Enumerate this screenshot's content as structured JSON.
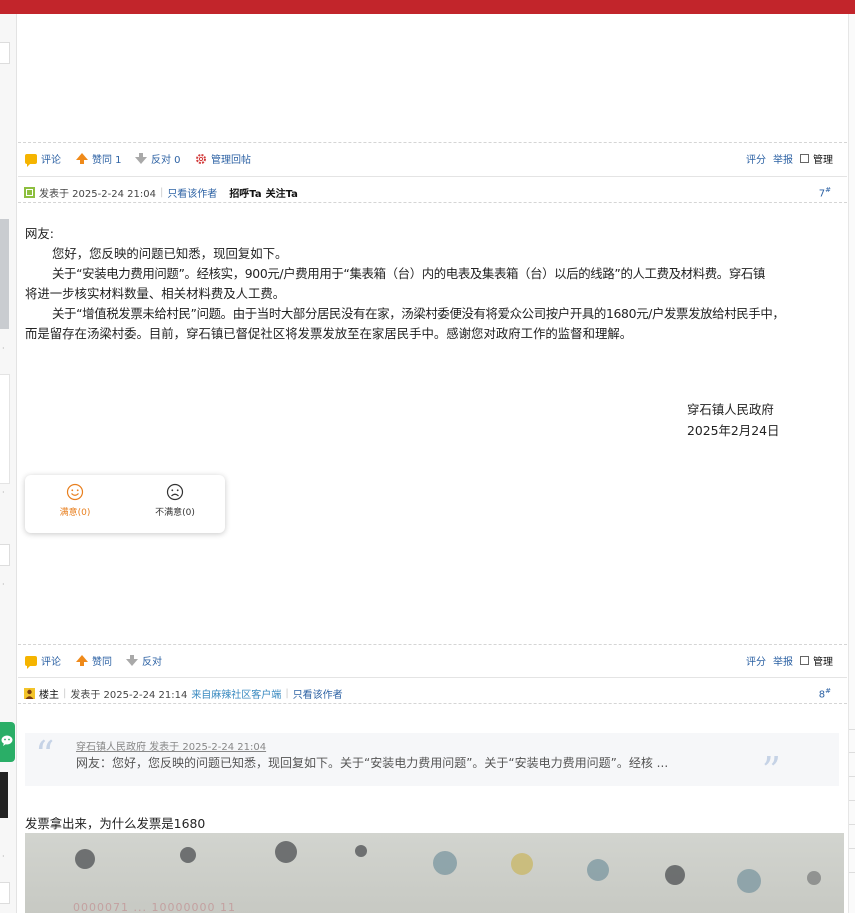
{
  "colors": {
    "brand_red": "#c2252b",
    "link_blue": "#2d62a4",
    "satisfied_orange": "#e87f1e"
  },
  "post6_actions": {
    "comment": "评论",
    "agree": "赞同 1",
    "oppose": "反对 0",
    "admin_reply": "管理回帖",
    "rate": "评分",
    "report": "举报",
    "manage": "管理"
  },
  "post7": {
    "posted": "发表于 2025-2-24 21:04",
    "only_author": "只看该作者",
    "greet": "招呼Ta",
    "follow": "关注Ta",
    "floor": "7",
    "floor_suffix": "#",
    "paragraphs": [
      "网友:",
      "您好，您反映的问题已知悉，现回复如下。",
      "关于“安装电力费用问题”。经核实，900元/户费用用于“集表箱（台）内的电表及集表箱（台）以后的线路”的人工费及材料费。穿石镇",
      "将进一步核实材料数量、相关材料费及人工费。",
      "关于“增值税发票未给村民”问题。由于当时大部分居民没有在家，汤梁村委便没有将爱众公司按户开具的1680元/户发票发放给村民手中，",
      "而是留存在汤梁村委。目前，穿石镇已督促社区将发票发放至在家居民手中。感谢您对政府工作的监督和理解。"
    ],
    "sign_org": "穿石镇人民政府",
    "sign_date": "2025年2月24日",
    "rating": {
      "satisfied": "满意(0)",
      "unsatisfied": "不满意(0)"
    },
    "actions": {
      "comment": "评论",
      "agree": "赞同",
      "oppose": "反对",
      "rate": "评分",
      "report": "举报",
      "manage": "管理"
    }
  },
  "post8": {
    "role": "楼主",
    "posted": "发表于 2025-2-24 21:14",
    "client": "来自麻辣社区客户端",
    "only_author": "只看该作者",
    "floor": "8",
    "floor_suffix": "#",
    "quote_meta": "穿石镇人民政府 发表于 2025-2-24 21:04",
    "quote_text": "网友：您好，您反映的问题已知悉，现回复如下。关于“安装电力费用问题”。关于“安装电力费用问题”。经核 ...",
    "reply_text": "发票拿出来，为什么发票是1680",
    "photo_text": "0000071 ... 10000000 11"
  },
  "icons": [
    "comment-icon",
    "thumb-up-icon",
    "thumb-down-icon",
    "gear-icon",
    "user-icon",
    "smile-icon",
    "frown-icon",
    "quote-icon",
    "wechat-icon"
  ]
}
